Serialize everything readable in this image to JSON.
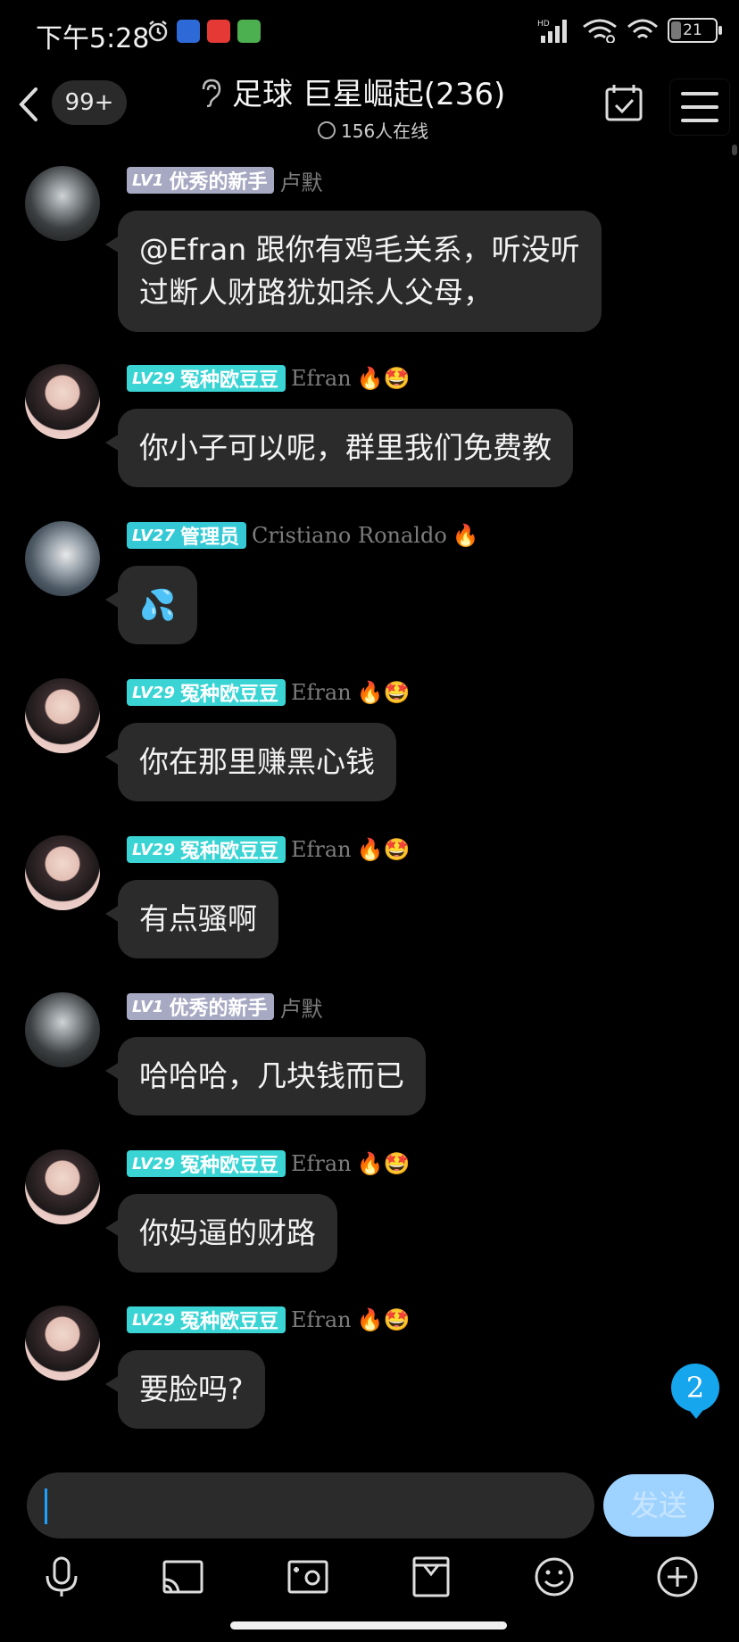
{
  "status": {
    "time": "下午5:28",
    "battery": "21",
    "network": "HD"
  },
  "header": {
    "unread_badge": "99+",
    "title": "足球 巨星崛起(236)",
    "online": "156人在线"
  },
  "messages": [
    {
      "avatar": "ludou",
      "level": "LV1",
      "title": "优秀的新手",
      "name": "卢默",
      "emojis": "",
      "text_lines": [
        "@Efran 跟你有鸡毛关系，听没听",
        "过断人财路犹如杀人父母，"
      ]
    },
    {
      "avatar": "efran",
      "level": "LV29",
      "title": "冤种欧豆豆",
      "name": "Efran",
      "emojis": "🔥🤩",
      "text_lines": [
        "你小子可以呢，群里我们免费教"
      ]
    },
    {
      "avatar": "cr",
      "level": "LV27",
      "title": "管理员",
      "name": "Cristiano Ronaldo",
      "emojis": "🔥",
      "text_lines": [
        "💦"
      ]
    },
    {
      "avatar": "efran",
      "level": "LV29",
      "title": "冤种欧豆豆",
      "name": "Efran",
      "emojis": "🔥🤩",
      "text_lines": [
        "你在那里赚黑心钱"
      ]
    },
    {
      "avatar": "efran",
      "level": "LV29",
      "title": "冤种欧豆豆",
      "name": "Efran",
      "emojis": "🔥🤩",
      "text_lines": [
        "有点骚啊"
      ]
    },
    {
      "avatar": "ludou",
      "level": "LV1",
      "title": "优秀的新手",
      "name": "卢默",
      "emojis": "",
      "text_lines": [
        "哈哈哈，几块钱而已"
      ]
    },
    {
      "avatar": "efran",
      "level": "LV29",
      "title": "冤种欧豆豆",
      "name": "Efran",
      "emojis": "🔥🤩",
      "text_lines": [
        "你妈逼的财路"
      ]
    },
    {
      "avatar": "efran",
      "level": "LV29",
      "title": "冤种欧豆豆",
      "name": "Efran",
      "emojis": "🔥🤩",
      "text_lines": [
        "要脸吗?"
      ]
    }
  ],
  "unread_count": "2",
  "composer": {
    "value": "",
    "send_label": "发送"
  },
  "toolbar": {
    "icons": [
      "microphone-icon",
      "screen-cast-icon",
      "photo-icon",
      "gift-box-icon",
      "emoji-icon",
      "add-circle-icon"
    ]
  },
  "colors": {
    "level_grey": "#a7a9c3",
    "level_cyan": "#3bd4d4",
    "bubble": "#2b2b2b",
    "accent": "#16a6ee",
    "send": "#9ed2ff"
  }
}
